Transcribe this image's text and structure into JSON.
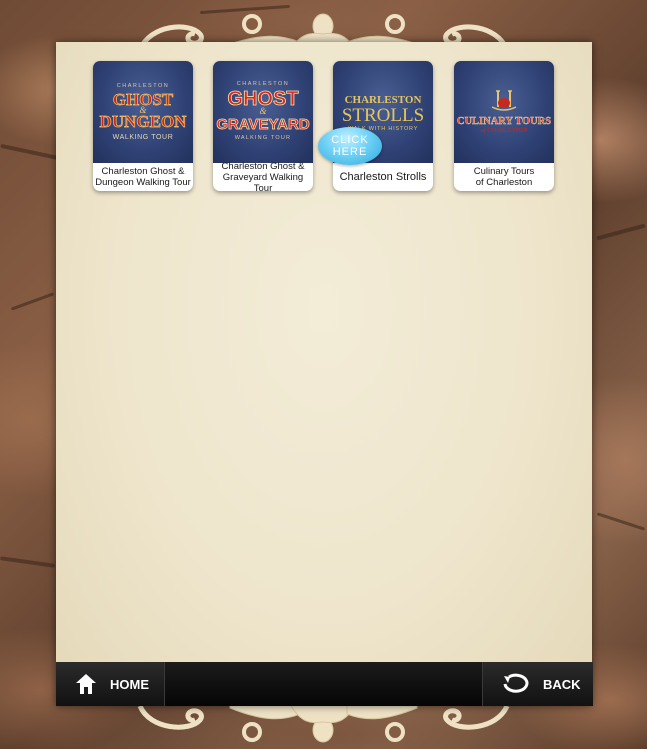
{
  "tours": [
    {
      "logo_lines": [
        "CHARLESTON",
        "GHOST",
        "&",
        "DUNGEON",
        "WALKING TOUR"
      ],
      "caption": "Charleston Ghost &\nDungeon Walking Tour"
    },
    {
      "logo_lines": [
        "CHARLESTON",
        "GHOST",
        "&",
        "GRAVEYARD",
        "WALKING TOUR"
      ],
      "caption": "Charleston Ghost &\nGraveyard Walking Tour"
    },
    {
      "logo_lines": [
        "CHARLESTON",
        "STROLLS",
        "WALK WITH HISTORY"
      ],
      "caption": "Charleston Strolls"
    },
    {
      "logo_lines": [
        "CULINARY TOURS",
        "of CHARLESTON"
      ],
      "caption": "Culinary Tours\nof Charleston"
    }
  ],
  "click_here": "CLICK\nHERE",
  "nav": {
    "home_label": "HOME",
    "back_label": "BACK"
  },
  "colors": {
    "paper": "#efe6cd",
    "tile_blue": "#2f4174",
    "bar": "#0a0a0a",
    "click_bubble": "#4cc0ec"
  },
  "icons": {
    "home": "home-icon",
    "back": "back-arrow-icon"
  }
}
